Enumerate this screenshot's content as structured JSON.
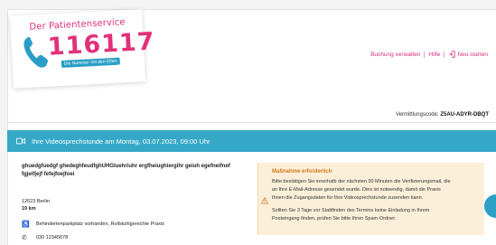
{
  "logo": {
    "title": "Der Patientenservice",
    "number": "116117",
    "subtitle": "Die Nummer mit den Elfen"
  },
  "nav": {
    "manage": "Buchung verwalten",
    "help": "Hilfe",
    "restart": "Neu starten"
  },
  "booking": {
    "code_label": "Vermittlungscode:",
    "code_value": "Z5AU-ADYR-DBQT"
  },
  "banner": {
    "text": "Ihre Videosprechstunde am Montag, 03.07.2023, 09:00 Uhr"
  },
  "practice": {
    "description": "ghuedgfuedgf ghedeghfeudfghUHGluehriuhr ergfheiughiergihr geiuh egefneifnef fgjeifjejf fefejfoejfoei",
    "city": "12623 Berlin",
    "distance": "19 km",
    "accessibility": "Behindertenparkplatz vorhanden, Rollstuhlgerechte Praxis",
    "phone": "030 12345678"
  },
  "notice": {
    "title": "Maßnahme erforderlich",
    "line1": "Bitte bestätigen Sie innerhalb der nächsten 30 Minuten die Verifizierungsmail, die",
    "line2": "an Ihre E-Mail-Adresse gesendet wurde. Dies ist notwendig, damit die Praxis",
    "line3": "Ihnen die Zugangsdaten für Ihre Videosprechstunde zusenden kann.",
    "line4": "Sollten Sie 3 Tage vor Stattfinden des Termins keine Einladung in Ihrem",
    "line5": "Posteingang finden, prüfen Sie bitte Ihren Spam-Ordner."
  },
  "colors": {
    "brand_pink": "#e3307a",
    "banner_blue": "#35a8c7",
    "notice_bg": "#fcefd9",
    "notice_title": "#d07a1a"
  }
}
